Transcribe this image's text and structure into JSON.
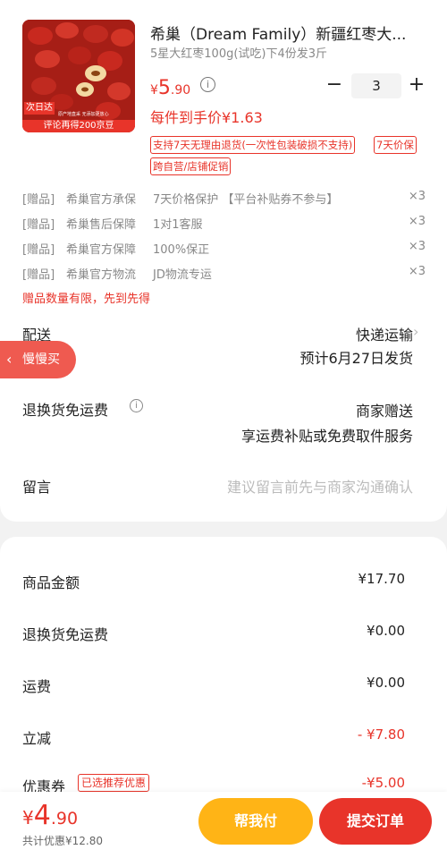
{
  "product": {
    "thumbnail": {
      "badge": "次日达",
      "banner": "评论再得200京豆",
      "small_text": "原产地直采 无添加更放心"
    },
    "title": "希巢（Dream Family）新疆红枣大...",
    "subtitle": "5星大红枣100g(试吃)下4份发3斤",
    "price": {
      "currency": "¥",
      "integer": "5",
      "decimal": ".90"
    },
    "quantity": "3",
    "unit_price_text": "每件到手价¥1.63",
    "tags": [
      "支持7天无理由退货(一次性包装破损不支持)",
      "7天价保",
      "跨自营/店铺促销"
    ]
  },
  "gifts": [
    {
      "label": "[赠品]",
      "name": "希巢官方承保",
      "desc": "7天价格保护 【平台补贴券不参与】",
      "count": "×3"
    },
    {
      "label": "[赠品]",
      "name": "希巢售后保障",
      "desc": "1对1客服",
      "count": "×3"
    },
    {
      "label": "[赠品]",
      "name": "希巢官方保障",
      "desc": "100%保正",
      "count": "×3"
    },
    {
      "label": "[赠品]",
      "name": "希巢官方物流",
      "desc": "JD物流专运",
      "count": "×3"
    }
  ],
  "gift_limit": "赠品数量有限，先到先得",
  "delivery": {
    "label": "配送",
    "method": "快递运输",
    "eta": "预计6月27日发货"
  },
  "float_button": {
    "label": "慢慢买",
    "arrow": "‹"
  },
  "return_shipping": {
    "label": "退换货免运费",
    "value": "商家赠送",
    "detail": "享运费补贴或免费取件服务"
  },
  "message": {
    "label": "留言",
    "placeholder": "建议留言前先与商家沟通确认"
  },
  "summary": {
    "items_label": "商品金额",
    "items_value": "¥17.70",
    "return_label": "退换货免运费",
    "return_value": "¥0.00",
    "shipping_label": "运费",
    "shipping_value": "¥0.00",
    "discount_label": "立减",
    "discount_value": "- ¥7.80",
    "coupon_label": "优惠券",
    "coupon_tag": "已选推荐优惠",
    "coupon_value": "-¥5.00"
  },
  "bottom": {
    "total": {
      "currency": "¥",
      "integer": "4",
      "decimal": ".90"
    },
    "saved": "共计优惠¥12.80",
    "help_button": "帮我付",
    "pay_button": "提交订单"
  },
  "colors": {
    "accent": "#e8342a",
    "help_button": "#ffb416",
    "float_button": "#ef5a50"
  }
}
